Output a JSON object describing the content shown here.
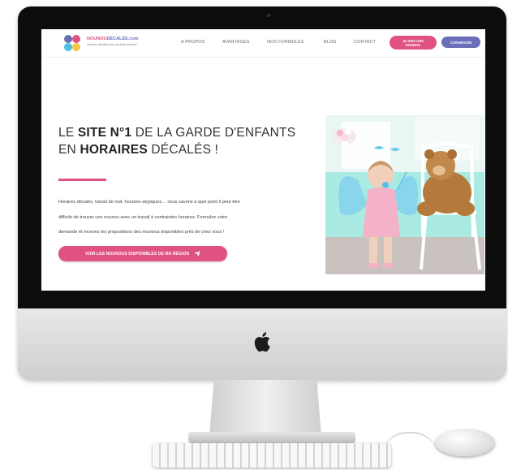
{
  "site": {
    "logo_brand": "NOUNOU",
    "logo_suffix": "DÉCALÉE.com",
    "logo_tagline": "horaires décalés pour parents heureux"
  },
  "nav": {
    "items": [
      "A PROPOS",
      "AVANTAGES",
      "NOS FORMULES",
      "BLOG",
      "CONTACT"
    ],
    "btn_nounou_line1": "JE SUIS UNE",
    "btn_nounou_line2": "NOUNOU",
    "btn_login": "CONNEXION"
  },
  "hero": {
    "title_p1": "LE ",
    "title_b1": "SITE N°1",
    "title_p2": " DE LA GARDE D'ENFANTS",
    "title_p3": "EN ",
    "title_b2": "HORAIRES",
    "title_p4": " DÉCALÉS !",
    "text_line1": "Horaires décalés, travail de nuit, horaires atypiques… nous savons à quel point il peut être",
    "text_line2": "difficile de trouver une nounou avec un travail à contraintes horaires. Formulez votre",
    "text_line3": "demande et recevez les propositions des nounous disponibles près de chez vous !",
    "cta_label": "VOIR LES NOUNOUS DISPONIBLES DE MA RÉGION",
    "cta_icon": "paper-plane-icon"
  },
  "colors": {
    "pink": "#e0527f",
    "purple": "#6b6fb8",
    "photo_wall": "#9be3da"
  }
}
